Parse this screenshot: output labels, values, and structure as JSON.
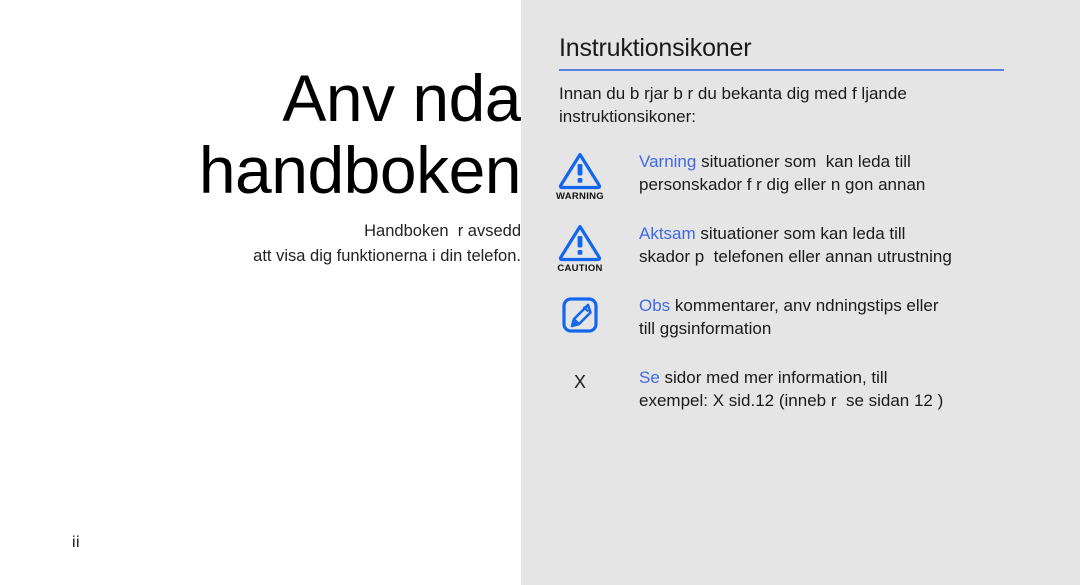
{
  "left": {
    "title_lines": [
      "Anv nda",
      "handboken"
    ],
    "subtitle_lines": [
      "Handboken  r avsedd",
      "att visa dig funktionerna i din telefon."
    ],
    "page_number": "ii"
  },
  "right": {
    "heading": "Instruktionsikoner",
    "rule_color": "#5b7fe0",
    "intro_lines": [
      "Innan du b rjar b r du bekanta dig med f ljande",
      "instruktionsikoner:"
    ],
    "accent_color": "#4169e1",
    "items": [
      {
        "icon": "warning-triangle-icon",
        "icon_caption": "WARNING",
        "keyword": "Varning",
        "lines": [
          " situationer som  kan leda till",
          "personskador f r dig eller n gon annan"
        ]
      },
      {
        "icon": "caution-triangle-icon",
        "icon_caption": "CAUTION",
        "keyword": "Aktsam",
        "lines": [
          " situationer som kan leda till",
          "skador p  telefonen eller annan utrustning"
        ]
      },
      {
        "icon": "note-pen-icon",
        "icon_caption": "",
        "keyword": "Obs",
        "lines": [
          " kommentarer, anv ndningstips eller",
          "till ggsinformation"
        ]
      },
      {
        "icon": "cross-reference-mark",
        "icon_glyph": "X",
        "icon_caption": "",
        "keyword": "Se",
        "lines": [
          " sidor med mer information, till",
          "exempel: X sid.12 (inneb r  se sidan 12 )"
        ]
      }
    ]
  }
}
